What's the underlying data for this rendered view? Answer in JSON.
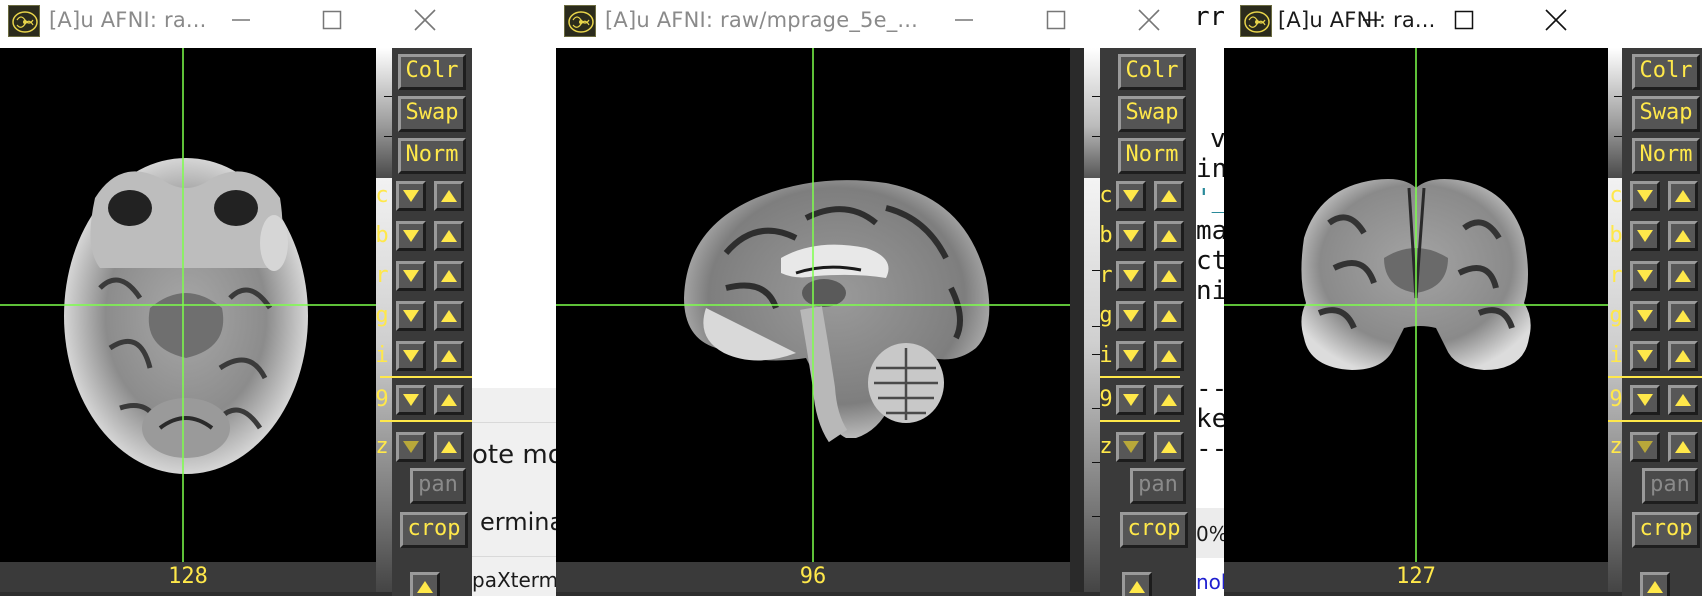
{
  "background": {
    "middle_panel": {
      "lines": [
        "ote mor",
        "erminal",
        "paXterm b"
      ]
    },
    "terminal": {
      "lines": [
        "rr",
        "v",
        "in",
        "'_",
        "ma",
        "ct",
        "ni",
        "--",
        "ke",
        "--"
      ],
      "percent": "0%",
      "link": "nob"
    }
  },
  "windows": [
    {
      "id": "axial",
      "title": "[A]u AFNI: ra...",
      "coord": "128",
      "buttons": {
        "colr": "Colr",
        "swap": "Swap",
        "norm": "Norm",
        "pan": "pan",
        "crop": "crop"
      },
      "row_letters": [
        "c",
        "b",
        "r",
        "g",
        "i",
        "9",
        "z"
      ]
    },
    {
      "id": "sagittal",
      "title": "[A]u AFNI: raw/mprage_5e_...",
      "coord": "96",
      "buttons": {
        "colr": "Colr",
        "swap": "Swap",
        "norm": "Norm",
        "pan": "pan",
        "crop": "crop"
      },
      "row_letters": [
        "c",
        "b",
        "r",
        "g",
        "i",
        "9",
        "z"
      ]
    },
    {
      "id": "coronal",
      "title": "[A]u AFNI: ra...",
      "coord": "127",
      "buttons": {
        "colr": "Colr",
        "swap": "Swap",
        "norm": "Norm",
        "pan": "pan",
        "crop": "crop"
      },
      "row_letters": [
        "c",
        "b",
        "r",
        "g",
        "i",
        "9",
        "z"
      ]
    }
  ],
  "colors": {
    "accent_yellow": "#ffe84a",
    "crosshair_green": "#7dff4a",
    "panel_gray": "#3a3a3a",
    "title_gray": "#8a8a8a"
  },
  "icons": {
    "app": "afni-brain-logo-icon",
    "minimize": "minimize-icon",
    "maximize": "maximize-icon",
    "close": "close-icon",
    "down_arrow": "arrow-down-icon",
    "up_arrow": "arrow-up-icon"
  }
}
